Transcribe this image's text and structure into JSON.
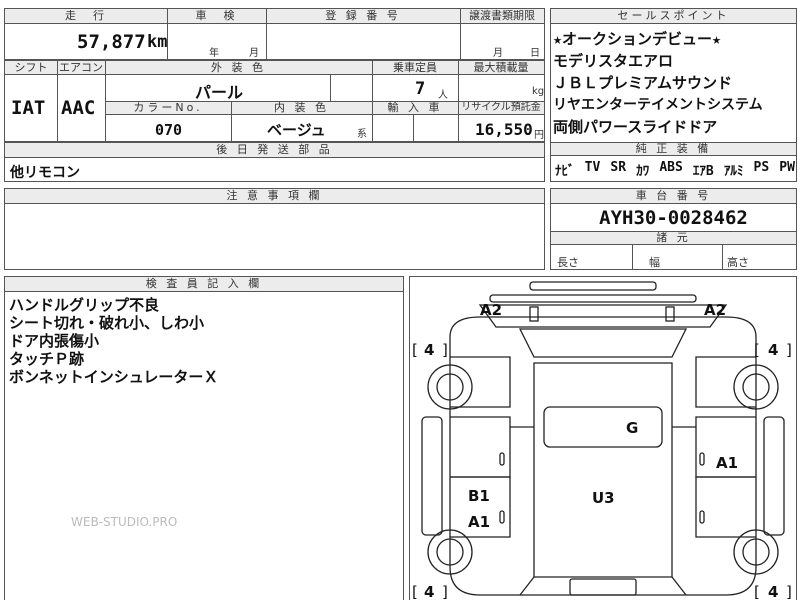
{
  "top": {
    "mileage_label": "走　行",
    "mileage_value": "57,877",
    "mileage_unit": "km",
    "inspection_label": "車　検",
    "inspection_year": "年",
    "inspection_month": "月",
    "registration_label": "登 録 番 号",
    "transfer_label": "譲渡書類期限",
    "transfer_month": "月",
    "transfer_day": "日"
  },
  "row2": {
    "shift_label": "シフト",
    "aircon_label": "エアコン",
    "shift_value": "IAT",
    "aircon_value": "AAC",
    "exterior_color_label": "外 装 色",
    "exterior_color_value": "パール",
    "capacity_label": "乗車定員",
    "capacity_value": "7",
    "capacity_unit": "人",
    "max_load_label": "最大積載量",
    "max_load_unit": "kg",
    "color_no_label": "カラーNo.",
    "color_no_value": "070",
    "interior_label": "内 装 色",
    "interior_value": "ベージュ",
    "interior_suffix": "系",
    "import_label": "輸 入 車",
    "recycle_label": "リサイクル預託金",
    "recycle_value": "16,550",
    "recycle_unit": "円"
  },
  "later_parts": {
    "label": "後 日 発 送 部 品",
    "value": "他リモコン"
  },
  "caution": {
    "label": "注 意 事 項 欄"
  },
  "selling_points": {
    "label": "セールスポイント",
    "items": [
      "★オークションデビュー★",
      "モデリスタエアロ",
      "ＪＢＬプレミアムサウンド",
      "リヤエンターテイメントシステム",
      "両側パワースライドドア"
    ]
  },
  "genuine_equipment": {
    "label": "純 正 装 備",
    "items": [
      "ﾅﾋﾞ",
      "TV",
      "SR",
      "ｶﾜ",
      "ABS",
      "ｴｱB",
      "ｱﾙﾐ",
      "PS",
      "PW"
    ]
  },
  "chassis": {
    "label": "車 台 番 号",
    "value": "AYH30-0028462"
  },
  "dimensions": {
    "label": "諸 元",
    "length_label": "長さ",
    "width_label": "幅",
    "height_label": "高さ"
  },
  "inspector": {
    "label": "検 査 員 記 入 欄",
    "notes": [
      "ハンドルグリップ不良",
      "シート切れ・破れ小、しわ小",
      "ドア内張傷小",
      "タッチＰ跡",
      "ボンネットインシュレーターＸ"
    ],
    "watermark": "WEB-STUDIO.PRO"
  },
  "diagram": {
    "marks": {
      "front_left": "A2",
      "front_right": "A2",
      "roof": "G",
      "right_door": "A1",
      "left_door_upper": "B1",
      "left_door_lower": "A1",
      "floor": "U3"
    },
    "tires": {
      "front_left": "4",
      "front_right": "4",
      "rear_left": "4",
      "rear_right": "4"
    },
    "bracket_open": "[",
    "bracket_close": "]"
  }
}
